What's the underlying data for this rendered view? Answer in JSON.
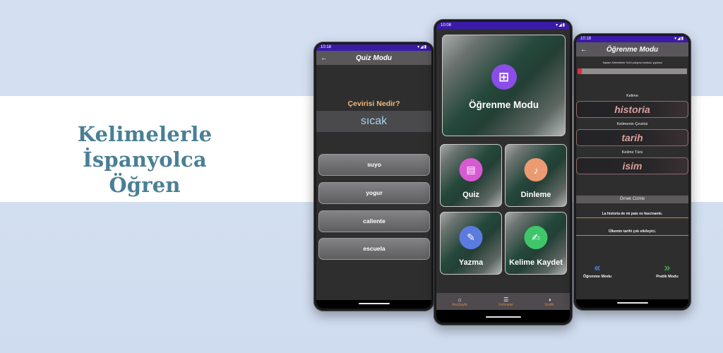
{
  "headline": {
    "line1": "Kelimelerle İspanyolca",
    "line2": "Öğren"
  },
  "colors": {
    "brand_text": "#4a7f94",
    "status_bar": "#3a1aa8",
    "accent_orange": "#d8893a",
    "progress_red": "#e62c3c"
  },
  "phone_left": {
    "status_time": "10:18",
    "status_icons": "▾◢▮",
    "back_icon": "←",
    "title": "Quiz Modu",
    "question": "Çevirisi Nedir?",
    "word": "sıcak",
    "options": [
      "suyo",
      "yogur",
      "caliente",
      "escuela"
    ]
  },
  "phone_center": {
    "status_time": "10:08",
    "status_icons": "▾◢▮",
    "cards": {
      "learn": {
        "label": "Öğrenme Modu",
        "icon": "⊞",
        "icon_name": "grid-icon",
        "icon_color": "#8a4de8"
      },
      "quiz": {
        "label": "Quiz",
        "icon": "▤",
        "icon_name": "cards-icon",
        "icon_color": "#d85ad2"
      },
      "listen": {
        "label": "Dinleme",
        "icon": "♪",
        "icon_name": "speaker-user-icon",
        "icon_color": "#ec9a72"
      },
      "write": {
        "label": "Yazma",
        "icon": "✎",
        "icon_name": "pencil-icon",
        "icon_color": "#5b7be0"
      },
      "save": {
        "label": "Kelime Kaydet",
        "icon": "✍",
        "icon_name": "edit-note-icon",
        "icon_color": "#3fc66a"
      }
    },
    "bottom_nav": [
      {
        "label": "AnaSayfa",
        "icon": "⌂",
        "icon_name": "home-icon"
      },
      {
        "label": "Kelimeler",
        "icon": "☰",
        "icon_name": "list-icon"
      },
      {
        "label": "Grafik",
        "icon": "◑",
        "icon_name": "pie-chart-icon"
      }
    ]
  },
  "phone_right": {
    "status_time": "10:18",
    "status_icons": "▾◢▮",
    "back_icon": "←",
    "title": "Öğrenme Modu",
    "progress_text": "Toplam Kelimelerin %4'ü çalışma modunu yaptınız",
    "progress_fraction": 0.04,
    "fields": [
      {
        "label": "Kelime",
        "value": "historia"
      },
      {
        "label": "Kelimenin Çevirisi",
        "value": "tarih"
      },
      {
        "label": "Kelime Türü",
        "value": "isim"
      }
    ],
    "sentence_header": "Örnek Cümle",
    "sentences": [
      "La historia de mi país es fascinante.",
      "Ülkemin tarihi çok etkileyici."
    ],
    "prev": {
      "icon": "«",
      "label": "Öğrenme Modu",
      "color": "#5b78d6"
    },
    "next": {
      "icon": "»",
      "label": "Pratik Modu",
      "color": "#3fa34a"
    }
  }
}
